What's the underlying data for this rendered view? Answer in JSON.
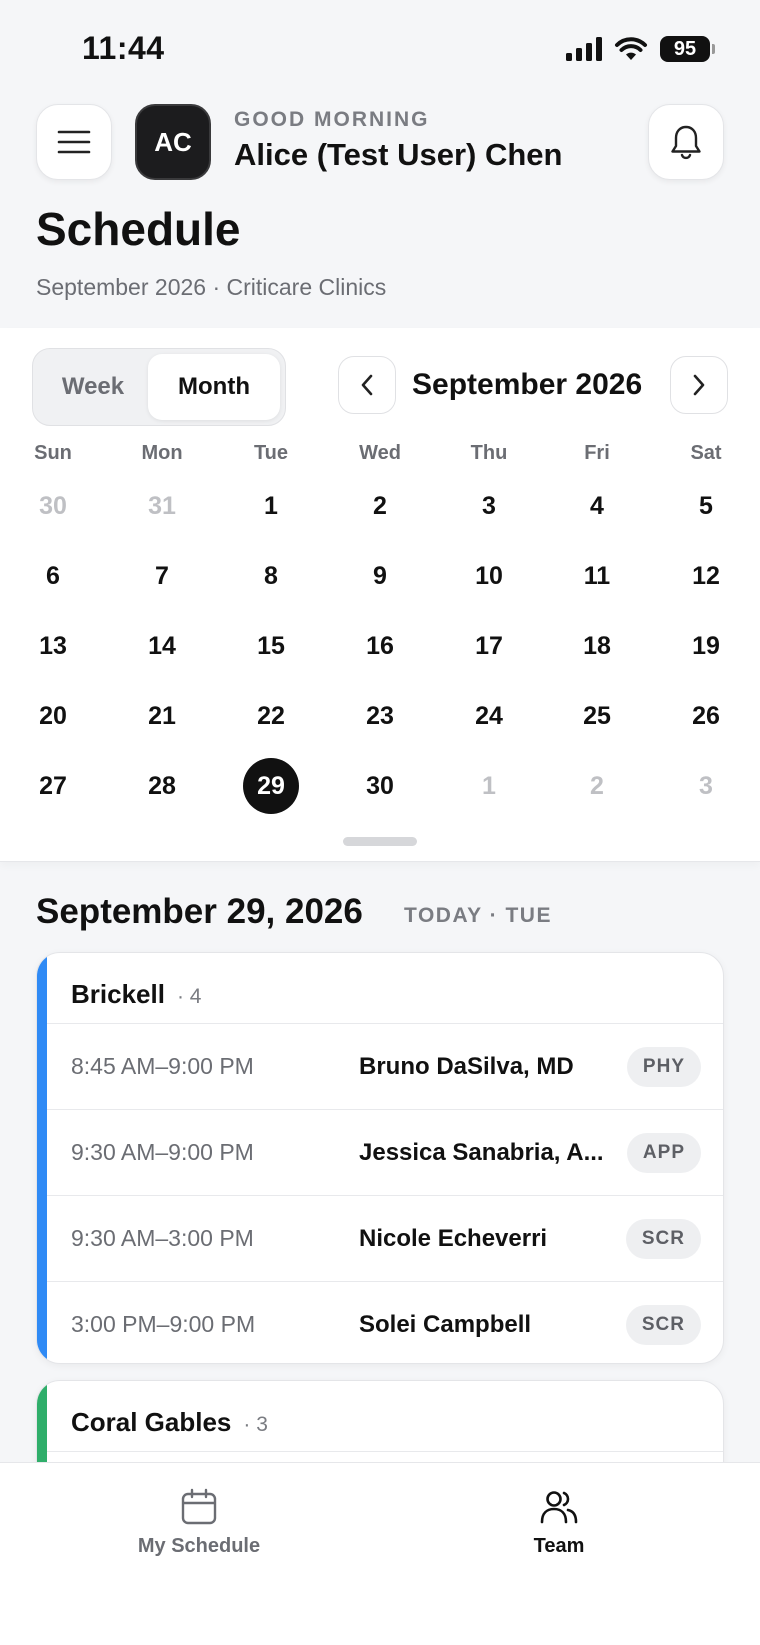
{
  "status_bar": {
    "time": "11:44",
    "battery": "95"
  },
  "header": {
    "avatar_initials": "AC",
    "greeting": "GOOD MORNING",
    "user_name": "Alice (Test User) Chen"
  },
  "page": {
    "title": "Schedule",
    "subtitle": "September 2026 · Criticare Clinics"
  },
  "calendar": {
    "view_toggle": {
      "week_label": "Week",
      "month_label": "Month",
      "selected": "Month"
    },
    "month_label": "September 2026",
    "weekdays": [
      "Sun",
      "Mon",
      "Tue",
      "Wed",
      "Thu",
      "Fri",
      "Sat"
    ],
    "weeks": [
      [
        {
          "d": "30",
          "muted": true
        },
        {
          "d": "31",
          "muted": true
        },
        {
          "d": "1"
        },
        {
          "d": "2"
        },
        {
          "d": "3"
        },
        {
          "d": "4"
        },
        {
          "d": "5"
        }
      ],
      [
        {
          "d": "6"
        },
        {
          "d": "7"
        },
        {
          "d": "8"
        },
        {
          "d": "9"
        },
        {
          "d": "10"
        },
        {
          "d": "11"
        },
        {
          "d": "12"
        }
      ],
      [
        {
          "d": "13"
        },
        {
          "d": "14"
        },
        {
          "d": "15"
        },
        {
          "d": "16"
        },
        {
          "d": "17"
        },
        {
          "d": "18"
        },
        {
          "d": "19"
        }
      ],
      [
        {
          "d": "20"
        },
        {
          "d": "21"
        },
        {
          "d": "22"
        },
        {
          "d": "23"
        },
        {
          "d": "24"
        },
        {
          "d": "25"
        },
        {
          "d": "26"
        }
      ],
      [
        {
          "d": "27"
        },
        {
          "d": "28"
        },
        {
          "d": "29",
          "selected": true
        },
        {
          "d": "30"
        },
        {
          "d": "1",
          "muted": true
        },
        {
          "d": "2",
          "muted": true
        },
        {
          "d": "3",
          "muted": true
        }
      ]
    ]
  },
  "day": {
    "title": "September 29, 2026",
    "tag": "TODAY · TUE"
  },
  "locations": [
    {
      "name": "Brickell",
      "count": "· 4",
      "accent_color": "#2f8af5",
      "shifts": [
        {
          "time": "8:45 AM–9:00 PM",
          "name": "Bruno DaSilva, MD",
          "role": "PHY"
        },
        {
          "time": "9:30 AM–9:00 PM",
          "name": "Jessica Sanabria, A...",
          "role": "APP"
        },
        {
          "time": "9:30 AM–3:00 PM",
          "name": "Nicole Echeverri",
          "role": "SCR"
        },
        {
          "time": "3:00 PM–9:00 PM",
          "name": "Solei Campbell",
          "role": "SCR"
        }
      ]
    },
    {
      "name": "Coral Gables",
      "count": "· 3",
      "accent_color": "#2fae6a"
    }
  ],
  "tabbar": {
    "my_schedule": {
      "label": "My Schedule",
      "icon": "calendar-icon"
    },
    "team": {
      "label": "Team",
      "icon": "people-icon",
      "active": true
    }
  },
  "colors": {
    "background": "#f5f6f8",
    "primary_text": "#111111",
    "secondary_text": "#6b6d73"
  }
}
